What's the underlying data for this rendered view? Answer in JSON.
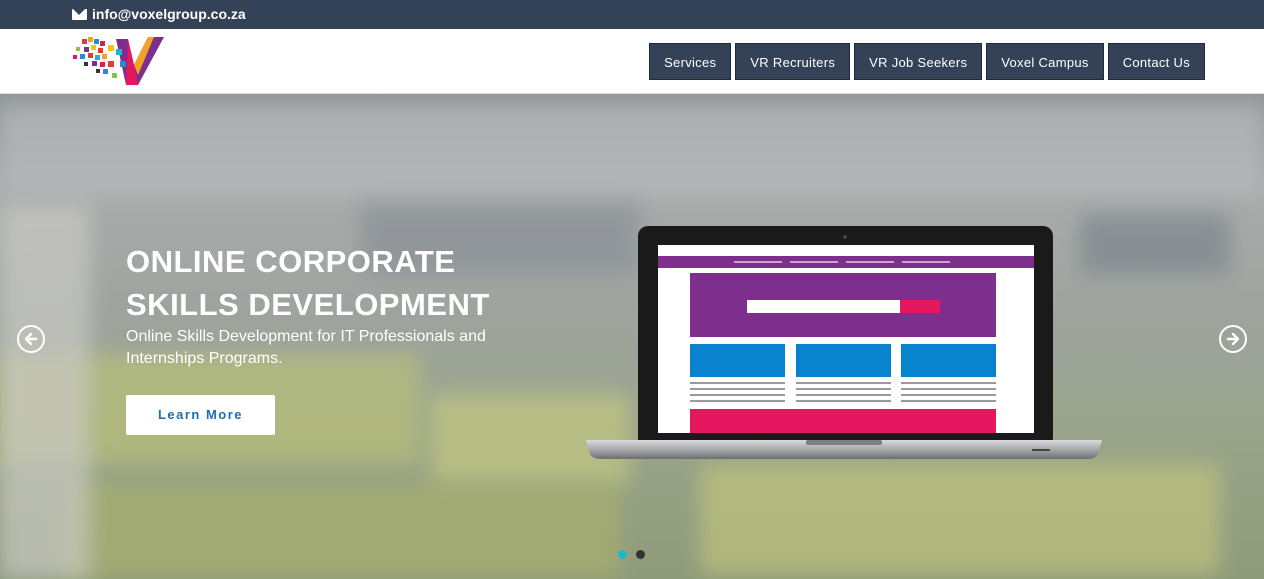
{
  "topbar": {
    "email": "info@voxelgroup.co.za",
    "icon": "mail-icon"
  },
  "nav": {
    "items": [
      {
        "label": "Services"
      },
      {
        "label": "VR Recruiters"
      },
      {
        "label": "VR Job Seekers"
      },
      {
        "label": "Voxel Campus"
      },
      {
        "label": "Contact Us"
      }
    ]
  },
  "hero": {
    "title_line1": "ONLINE CORPORATE",
    "title_line2": "SKILLS DEVELOPMENT",
    "subtitle": "Online Skills Development for IT Professionals and Internships Programs.",
    "button_label": "Learn More"
  },
  "carousel": {
    "slides": 2,
    "active": 0,
    "active_color": "#1fb6c9",
    "inactive_color": "#333333"
  },
  "colors": {
    "topbar": "#334257",
    "accent": "#1b6fb5",
    "laptop_header": "#7e2f8e",
    "laptop_blue": "#0a83cf",
    "laptop_pink": "#e5175f"
  }
}
